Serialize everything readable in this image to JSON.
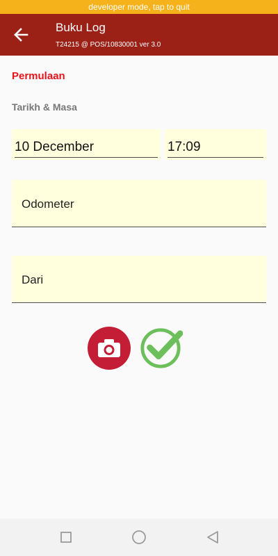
{
  "dev_banner": "developer mode, tap to quit",
  "appbar": {
    "title": "Buku Log",
    "subtitle": "T24215 @ POS/10830001 ver 3.0",
    "back_icon": "arrow-left-icon"
  },
  "form": {
    "section_heading": "Permulaan",
    "datetime_label": "Tarikh & Masa",
    "date_value": "10 December",
    "time_value": "17:09",
    "odometer_placeholder": "Odometer",
    "from_placeholder": "Dari"
  },
  "actions": {
    "camera_icon": "camera-icon",
    "confirm_icon": "check-circle-icon"
  },
  "navbar": {
    "keys": [
      "recent-apps-icon",
      "home-icon",
      "back-triangle-icon"
    ]
  },
  "colors": {
    "banner": "#f6b21b",
    "appbar": "#9b2116",
    "heading": "#e8141b",
    "field_bg": "#ffffde",
    "camera_btn": "#c41e36",
    "confirm_btn": "#6cbf5a"
  }
}
